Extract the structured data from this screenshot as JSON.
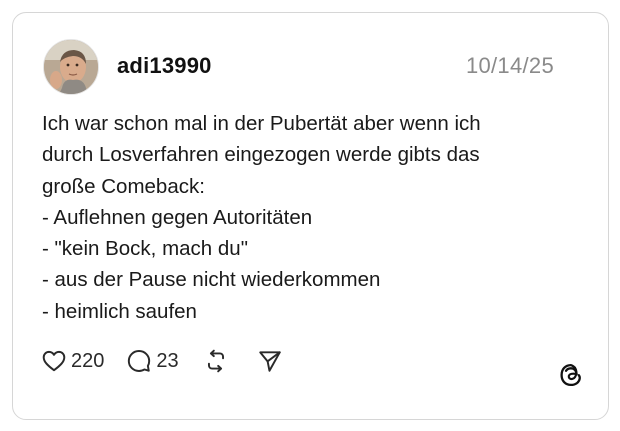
{
  "post": {
    "username": "adi13990",
    "date": "10/14/25",
    "lines": [
      "Ich war schon mal in der Pubertät aber wenn ich",
      "durch Losverfahren eingezogen werde gibts das",
      "große Comeback:",
      "- Auflehnen gegen Autoritäten",
      "- \"kein Bock, mach du\"",
      "- aus der Pause nicht wiederkommen",
      "- heimlich saufen"
    ]
  },
  "actions": {
    "likes_count": "220",
    "replies_count": "23",
    "like_icon": "heart-icon",
    "reply_icon": "speech-bubble-icon",
    "repost_icon": "repost-icon",
    "share_icon": "paper-plane-icon"
  },
  "branding": {
    "logo_icon": "threads-logo-icon"
  },
  "colors": {
    "card_border": "#d6d6d6",
    "text": "#111111",
    "muted": "#8a8a8a"
  }
}
